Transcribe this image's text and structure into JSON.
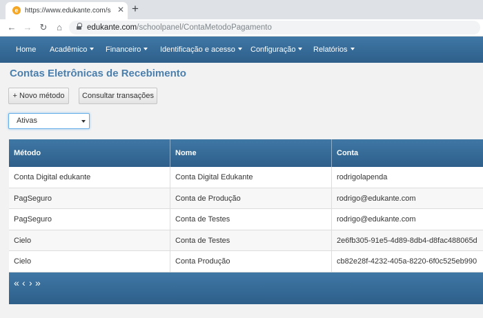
{
  "browser": {
    "tab_title": "https://www.edukante.com/schoolpanel/ContaMetodoPagamento",
    "favicon_letter": "e",
    "url_host": "edukante.com",
    "url_path": "/schoolpanel/ContaMetodoPagamento",
    "icons": [
      "close-icon",
      "plus-icon",
      "back-arrow-icon",
      "forward-arrow-icon",
      "reload-icon",
      "home-icon",
      "lock-icon"
    ]
  },
  "nav": {
    "items": [
      {
        "label": "Home",
        "dropdown": false
      },
      {
        "label": "Acadêmico",
        "dropdown": true
      },
      {
        "label": "Financeiro",
        "dropdown": true
      },
      {
        "label": "Identificação e acesso",
        "dropdown": true
      },
      {
        "label": "Configuração",
        "dropdown": true
      },
      {
        "label": "Relatórios",
        "dropdown": true
      }
    ]
  },
  "page": {
    "title": "Contas Eletrônicas de Recebimento",
    "new_button": "+ Novo método",
    "transactions_button": "Consultar transações",
    "status_filter": "Ativas"
  },
  "table": {
    "columns": [
      "Método",
      "Nome",
      "Conta"
    ],
    "rows": [
      [
        "Conta Digital edukante",
        "Conta Digital Edukante",
        "rodrigolapenda"
      ],
      [
        "PagSeguro",
        "Conta de Produção",
        "rodrigo@edukante.com"
      ],
      [
        "PagSeguro",
        "Conta de Testes",
        "rodrigo@edukante.com"
      ],
      [
        "Cielo",
        "Conta de Testes",
        "2e6fb305-91e5-4d89-8db4-d8fac488065d"
      ],
      [
        "Cielo",
        "Conta Produção",
        "cb82e28f-4232-405a-8220-6f0c525eb990"
      ]
    ],
    "pager_symbols": [
      "«",
      "‹",
      "›",
      "»"
    ]
  },
  "colors": {
    "nav_blue": "#3a6f9c",
    "title_blue": "#4a7fad",
    "select_focus": "#66afe9"
  }
}
